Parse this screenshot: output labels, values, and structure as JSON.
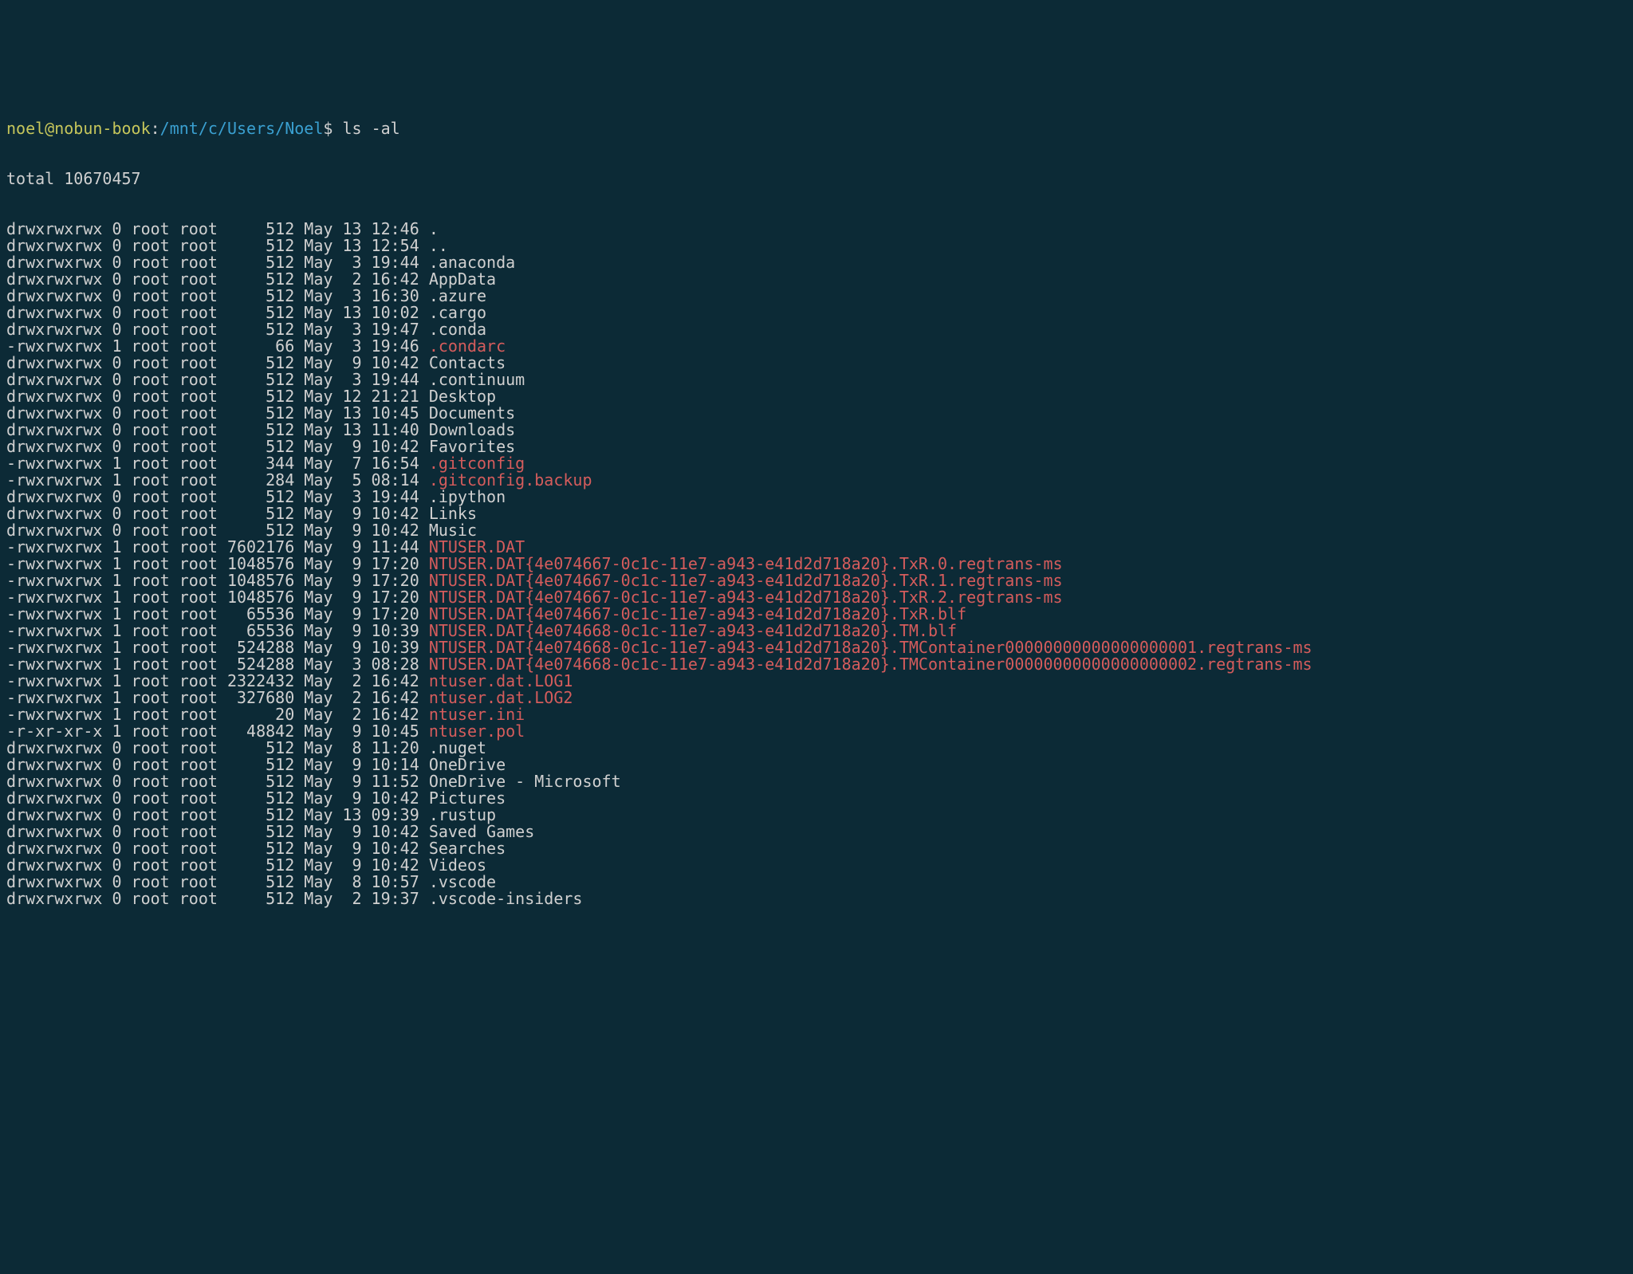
{
  "prompt": {
    "user_host": "noel@nobun-book",
    "colon": ":",
    "path": "/mnt/c/Users/Noel",
    "dollar": "$",
    "command": "ls -al"
  },
  "total_line": "total 10670457",
  "rows": [
    {
      "perm": "drwxrwxrwx",
      "links": "0",
      "owner": "root",
      "group": "root",
      "size": "512",
      "month": "May",
      "day": "13",
      "time": "12:46",
      "name": ".",
      "style": "dir"
    },
    {
      "perm": "drwxrwxrwx",
      "links": "0",
      "owner": "root",
      "group": "root",
      "size": "512",
      "month": "May",
      "day": "13",
      "time": "12:54",
      "name": "..",
      "style": "dir"
    },
    {
      "perm": "drwxrwxrwx",
      "links": "0",
      "owner": "root",
      "group": "root",
      "size": "512",
      "month": "May",
      "day": " 3",
      "time": "19:44",
      "name": ".anaconda",
      "style": "dir"
    },
    {
      "perm": "drwxrwxrwx",
      "links": "0",
      "owner": "root",
      "group": "root",
      "size": "512",
      "month": "May",
      "day": " 2",
      "time": "16:42",
      "name": "AppData",
      "style": "dir"
    },
    {
      "perm": "drwxrwxrwx",
      "links": "0",
      "owner": "root",
      "group": "root",
      "size": "512",
      "month": "May",
      "day": " 3",
      "time": "16:30",
      "name": ".azure",
      "style": "dir"
    },
    {
      "perm": "drwxrwxrwx",
      "links": "0",
      "owner": "root",
      "group": "root",
      "size": "512",
      "month": "May",
      "day": "13",
      "time": "10:02",
      "name": ".cargo",
      "style": "dir"
    },
    {
      "perm": "drwxrwxrwx",
      "links": "0",
      "owner": "root",
      "group": "root",
      "size": "512",
      "month": "May",
      "day": " 3",
      "time": "19:47",
      "name": ".conda",
      "style": "dir"
    },
    {
      "perm": "-rwxrwxrwx",
      "links": "1",
      "owner": "root",
      "group": "root",
      "size": "66",
      "month": "May",
      "day": " 3",
      "time": "19:46",
      "name": ".condarc",
      "style": "file-red"
    },
    {
      "perm": "drwxrwxrwx",
      "links": "0",
      "owner": "root",
      "group": "root",
      "size": "512",
      "month": "May",
      "day": " 9",
      "time": "10:42",
      "name": "Contacts",
      "style": "dir"
    },
    {
      "perm": "drwxrwxrwx",
      "links": "0",
      "owner": "root",
      "group": "root",
      "size": "512",
      "month": "May",
      "day": " 3",
      "time": "19:44",
      "name": ".continuum",
      "style": "dir"
    },
    {
      "perm": "drwxrwxrwx",
      "links": "0",
      "owner": "root",
      "group": "root",
      "size": "512",
      "month": "May",
      "day": "12",
      "time": "21:21",
      "name": "Desktop",
      "style": "dir"
    },
    {
      "perm": "drwxrwxrwx",
      "links": "0",
      "owner": "root",
      "group": "root",
      "size": "512",
      "month": "May",
      "day": "13",
      "time": "10:45",
      "name": "Documents",
      "style": "dir"
    },
    {
      "perm": "drwxrwxrwx",
      "links": "0",
      "owner": "root",
      "group": "root",
      "size": "512",
      "month": "May",
      "day": "13",
      "time": "11:40",
      "name": "Downloads",
      "style": "dir"
    },
    {
      "perm": "drwxrwxrwx",
      "links": "0",
      "owner": "root",
      "group": "root",
      "size": "512",
      "month": "May",
      "day": " 9",
      "time": "10:42",
      "name": "Favorites",
      "style": "dir"
    },
    {
      "perm": "-rwxrwxrwx",
      "links": "1",
      "owner": "root",
      "group": "root",
      "size": "344",
      "month": "May",
      "day": " 7",
      "time": "16:54",
      "name": ".gitconfig",
      "style": "file-red"
    },
    {
      "perm": "-rwxrwxrwx",
      "links": "1",
      "owner": "root",
      "group": "root",
      "size": "284",
      "month": "May",
      "day": " 5",
      "time": "08:14",
      "name": ".gitconfig.backup",
      "style": "file-red"
    },
    {
      "perm": "drwxrwxrwx",
      "links": "0",
      "owner": "root",
      "group": "root",
      "size": "512",
      "month": "May",
      "day": " 3",
      "time": "19:44",
      "name": ".ipython",
      "style": "dir"
    },
    {
      "perm": "drwxrwxrwx",
      "links": "0",
      "owner": "root",
      "group": "root",
      "size": "512",
      "month": "May",
      "day": " 9",
      "time": "10:42",
      "name": "Links",
      "style": "dir"
    },
    {
      "perm": "drwxrwxrwx",
      "links": "0",
      "owner": "root",
      "group": "root",
      "size": "512",
      "month": "May",
      "day": " 9",
      "time": "10:42",
      "name": "Music",
      "style": "dir"
    },
    {
      "perm": "-rwxrwxrwx",
      "links": "1",
      "owner": "root",
      "group": "root",
      "size": "7602176",
      "month": "May",
      "day": " 9",
      "time": "11:44",
      "name": "NTUSER.DAT",
      "style": "file-red"
    },
    {
      "perm": "-rwxrwxrwx",
      "links": "1",
      "owner": "root",
      "group": "root",
      "size": "1048576",
      "month": "May",
      "day": " 9",
      "time": "17:20",
      "name": "NTUSER.DAT{4e074667-0c1c-11e7-a943-e41d2d718a20}.TxR.0.regtrans-ms",
      "style": "file-red"
    },
    {
      "perm": "-rwxrwxrwx",
      "links": "1",
      "owner": "root",
      "group": "root",
      "size": "1048576",
      "month": "May",
      "day": " 9",
      "time": "17:20",
      "name": "NTUSER.DAT{4e074667-0c1c-11e7-a943-e41d2d718a20}.TxR.1.regtrans-ms",
      "style": "file-red"
    },
    {
      "perm": "-rwxrwxrwx",
      "links": "1",
      "owner": "root",
      "group": "root",
      "size": "1048576",
      "month": "May",
      "day": " 9",
      "time": "17:20",
      "name": "NTUSER.DAT{4e074667-0c1c-11e7-a943-e41d2d718a20}.TxR.2.regtrans-ms",
      "style": "file-red"
    },
    {
      "perm": "-rwxrwxrwx",
      "links": "1",
      "owner": "root",
      "group": "root",
      "size": "65536",
      "month": "May",
      "day": " 9",
      "time": "17:20",
      "name": "NTUSER.DAT{4e074667-0c1c-11e7-a943-e41d2d718a20}.TxR.blf",
      "style": "file-red"
    },
    {
      "perm": "-rwxrwxrwx",
      "links": "1",
      "owner": "root",
      "group": "root",
      "size": "65536",
      "month": "May",
      "day": " 9",
      "time": "10:39",
      "name": "NTUSER.DAT{4e074668-0c1c-11e7-a943-e41d2d718a20}.TM.blf",
      "style": "file-red"
    },
    {
      "perm": "-rwxrwxrwx",
      "links": "1",
      "owner": "root",
      "group": "root",
      "size": "524288",
      "month": "May",
      "day": " 9",
      "time": "10:39",
      "name": "NTUSER.DAT{4e074668-0c1c-11e7-a943-e41d2d718a20}.TMContainer00000000000000000001.regtrans-ms",
      "style": "file-red"
    },
    {
      "perm": "-rwxrwxrwx",
      "links": "1",
      "owner": "root",
      "group": "root",
      "size": "524288",
      "month": "May",
      "day": " 3",
      "time": "08:28",
      "name": "NTUSER.DAT{4e074668-0c1c-11e7-a943-e41d2d718a20}.TMContainer00000000000000000002.regtrans-ms",
      "style": "file-red"
    },
    {
      "perm": "-rwxrwxrwx",
      "links": "1",
      "owner": "root",
      "group": "root",
      "size": "2322432",
      "month": "May",
      "day": " 2",
      "time": "16:42",
      "name": "ntuser.dat.LOG1",
      "style": "file-red"
    },
    {
      "perm": "-rwxrwxrwx",
      "links": "1",
      "owner": "root",
      "group": "root",
      "size": "327680",
      "month": "May",
      "day": " 2",
      "time": "16:42",
      "name": "ntuser.dat.LOG2",
      "style": "file-red"
    },
    {
      "perm": "-rwxrwxrwx",
      "links": "1",
      "owner": "root",
      "group": "root",
      "size": "20",
      "month": "May",
      "day": " 2",
      "time": "16:42",
      "name": "ntuser.ini",
      "style": "file-red"
    },
    {
      "perm": "-r-xr-xr-x",
      "links": "1",
      "owner": "root",
      "group": "root",
      "size": "48842",
      "month": "May",
      "day": " 9",
      "time": "10:45",
      "name": "ntuser.pol",
      "style": "file-red"
    },
    {
      "perm": "drwxrwxrwx",
      "links": "0",
      "owner": "root",
      "group": "root",
      "size": "512",
      "month": "May",
      "day": " 8",
      "time": "11:20",
      "name": ".nuget",
      "style": "dir"
    },
    {
      "perm": "drwxrwxrwx",
      "links": "0",
      "owner": "root",
      "group": "root",
      "size": "512",
      "month": "May",
      "day": " 9",
      "time": "10:14",
      "name": "OneDrive",
      "style": "dir"
    },
    {
      "perm": "drwxrwxrwx",
      "links": "0",
      "owner": "root",
      "group": "root",
      "size": "512",
      "month": "May",
      "day": " 9",
      "time": "11:52",
      "name": "OneDrive - Microsoft",
      "style": "dir"
    },
    {
      "perm": "drwxrwxrwx",
      "links": "0",
      "owner": "root",
      "group": "root",
      "size": "512",
      "month": "May",
      "day": " 9",
      "time": "10:42",
      "name": "Pictures",
      "style": "dir"
    },
    {
      "perm": "drwxrwxrwx",
      "links": "0",
      "owner": "root",
      "group": "root",
      "size": "512",
      "month": "May",
      "day": "13",
      "time": "09:39",
      "name": ".rustup",
      "style": "dir"
    },
    {
      "perm": "drwxrwxrwx",
      "links": "0",
      "owner": "root",
      "group": "root",
      "size": "512",
      "month": "May",
      "day": " 9",
      "time": "10:42",
      "name": "Saved Games",
      "style": "dir"
    },
    {
      "perm": "drwxrwxrwx",
      "links": "0",
      "owner": "root",
      "group": "root",
      "size": "512",
      "month": "May",
      "day": " 9",
      "time": "10:42",
      "name": "Searches",
      "style": "dir"
    },
    {
      "perm": "drwxrwxrwx",
      "links": "0",
      "owner": "root",
      "group": "root",
      "size": "512",
      "month": "May",
      "day": " 9",
      "time": "10:42",
      "name": "Videos",
      "style": "dir"
    },
    {
      "perm": "drwxrwxrwx",
      "links": "0",
      "owner": "root",
      "group": "root",
      "size": "512",
      "month": "May",
      "day": " 8",
      "time": "10:57",
      "name": ".vscode",
      "style": "dir"
    },
    {
      "perm": "drwxrwxrwx",
      "links": "0",
      "owner": "root",
      "group": "root",
      "size": "512",
      "month": "May",
      "day": " 2",
      "time": "19:37",
      "name": ".vscode-insiders",
      "style": "dir"
    }
  ]
}
